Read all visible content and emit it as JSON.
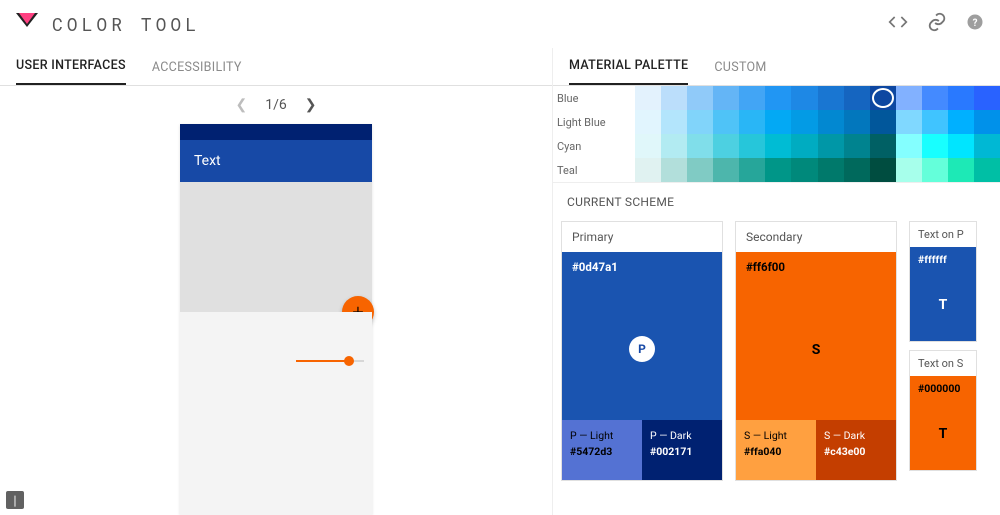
{
  "app": {
    "title": "COLOR TOOL"
  },
  "left_tabs": [
    {
      "label": "USER INTERFACES",
      "active": true
    },
    {
      "label": "ACCESSIBILITY",
      "active": false
    }
  ],
  "pager": {
    "current": 1,
    "total": 6,
    "display": "1/6"
  },
  "preview": {
    "appbar_text": "Text",
    "statusbar_color": "#002171",
    "appbar_color": "#1749a6",
    "fab_color": "#f76400",
    "accent_color": "#f76400"
  },
  "right_tabs": [
    {
      "label": "MATERIAL PALETTE",
      "active": true
    },
    {
      "label": "CUSTOM",
      "active": false
    }
  ],
  "palette_rows": [
    {
      "name": "Blue",
      "colors": [
        "#e3f2fd",
        "#bbdefb",
        "#90caf9",
        "#64b5f6",
        "#42a5f5",
        "#2196f3",
        "#1e88e5",
        "#1976d2",
        "#1565c0",
        "#0d47a1",
        "#82b1ff",
        "#448aff",
        "#2979ff",
        "#2962ff"
      ],
      "selected_index": 9
    },
    {
      "name": "Light Blue",
      "colors": [
        "#e1f5fe",
        "#b3e5fc",
        "#81d4fa",
        "#4fc3f7",
        "#29b6f6",
        "#03a9f4",
        "#039be5",
        "#0288d1",
        "#0277bd",
        "#01579b",
        "#80d8ff",
        "#40c4ff",
        "#00b0ff",
        "#0091ea"
      ]
    },
    {
      "name": "Cyan",
      "colors": [
        "#e0f7fa",
        "#b2ebf2",
        "#80deea",
        "#4dd0e1",
        "#26c6da",
        "#00bcd4",
        "#00acc1",
        "#0097a7",
        "#00838f",
        "#006064",
        "#84ffff",
        "#18ffff",
        "#00e5ff",
        "#00b8d4"
      ]
    },
    {
      "name": "Teal",
      "colors": [
        "#e0f2f1",
        "#b2dfdb",
        "#80cbc4",
        "#4db6ac",
        "#26a69a",
        "#009688",
        "#00897b",
        "#00796b",
        "#00695c",
        "#004d40",
        "#a7ffeb",
        "#64ffda",
        "#1de9b6",
        "#00bfa5"
      ]
    }
  ],
  "scheme": {
    "title": "CURRENT SCHEME",
    "primary": {
      "header": "Primary",
      "main_hex": "#0d47a1",
      "main_color": "#1a54b0",
      "badge_letter": "P",
      "badge_bg": "#ffffff",
      "badge_fg": "#1a54b0",
      "light": {
        "label": "P — Light",
        "hex": "#5472d3",
        "bg": "#5472d3",
        "fg": "#000"
      },
      "dark": {
        "label": "P — Dark",
        "hex": "#002171",
        "bg": "#002171",
        "fg": "#fff"
      }
    },
    "secondary": {
      "header": "Secondary",
      "main_hex": "#ff6f00",
      "main_color": "#f76400",
      "badge_letter": "S",
      "badge_fg": "#000",
      "light": {
        "label": "S — Light",
        "hex": "#ffa040",
        "bg": "#ffa040",
        "fg": "#000"
      },
      "dark": {
        "label": "S — Dark",
        "hex": "#c43e00",
        "bg": "#c43e00",
        "fg": "#fff"
      }
    },
    "text_p": {
      "header": "Text on P",
      "hex": "#ffffff",
      "bg": "#1a54b0",
      "fg": "#fff",
      "letter": "T"
    },
    "text_s": {
      "header": "Text on S",
      "hex": "#000000",
      "bg": "#f76400",
      "fg": "#000",
      "letter": "T"
    }
  }
}
